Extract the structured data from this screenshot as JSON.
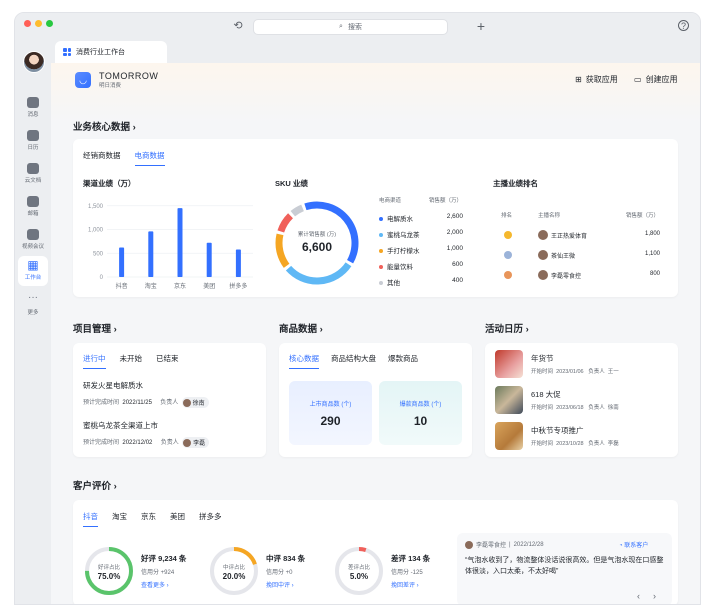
{
  "colors": {
    "accent": "#3370ff",
    "green": "#5ac46b",
    "orange": "#f5a623",
    "red": "#f0605a"
  },
  "app": {
    "search_placeholder": "搜索"
  },
  "sidebar": {
    "items": [
      {
        "label": "消息",
        "icon": "chat-icon"
      },
      {
        "label": "日历",
        "icon": "calendar-icon"
      },
      {
        "label": "云文档",
        "icon": "doc-icon"
      },
      {
        "label": "邮箱",
        "icon": "mail-icon"
      },
      {
        "label": "视频会议",
        "icon": "video-icon"
      },
      {
        "label": "工作台",
        "icon": "apps-icon"
      },
      {
        "label": "更多",
        "icon": "more-icon"
      }
    ]
  },
  "tab": {
    "title": "消费行业工作台"
  },
  "brand": {
    "name": "TOMORROW",
    "sub": "明日消费"
  },
  "header": {
    "get_app": "获取应用",
    "create_app": "创建应用"
  },
  "business": {
    "title": "业务核心数据",
    "tabs": [
      "经销商数据",
      "电商数据"
    ],
    "active_tab": 1,
    "channel_title": "渠道业绩（万）",
    "sku_title": "SKU 业绩",
    "anchor_title": "主播业绩排名"
  },
  "chart_data": {
    "type": "bar",
    "title": "渠道业绩（万）",
    "categories": [
      "抖音",
      "淘宝",
      "京东",
      "美团",
      "拼多多"
    ],
    "values": [
      620,
      960,
      1450,
      720,
      580
    ],
    "yticks": [
      0,
      500,
      1000,
      1500
    ],
    "ytick_labels": [
      "0",
      "500",
      "1,000",
      "1,500"
    ],
    "ylim": [
      0,
      1600
    ],
    "grid": true
  },
  "sku": {
    "center_label": "累计销售额 (万)",
    "center_value": "6,600",
    "col_channel": "电商渠道",
    "col_sales": "销售额（万）",
    "rows": [
      {
        "name": "电解质水",
        "value": "2,600",
        "num": 2600,
        "color": "#3370ff"
      },
      {
        "name": "蜜桃乌龙茶",
        "value": "2,000",
        "num": 2000,
        "color": "#5fb8f5"
      },
      {
        "name": "手打柠檬水",
        "value": "1,000",
        "num": 1000,
        "color": "#f5a623"
      },
      {
        "name": "能量饮料",
        "value": "600",
        "num": 600,
        "color": "#f0605a"
      },
      {
        "name": "其他",
        "value": "400",
        "num": 400,
        "color": "#c9cdd4"
      }
    ]
  },
  "anchors": {
    "col_rank": "排名",
    "col_name": "主播名称",
    "col_sales": "销售额（万）",
    "rows": [
      {
        "name": "王正热爱体育",
        "value": "1,800",
        "medal": "#f5b82e"
      },
      {
        "name": "茶仙王微",
        "value": "1,100",
        "medal": "#9bb3d9"
      },
      {
        "name": "李磊零食控",
        "value": "800",
        "medal": "#e8955a"
      }
    ]
  },
  "projects": {
    "title": "项目管理",
    "tabs": [
      "进行中",
      "未开始",
      "已结束"
    ],
    "items": [
      {
        "name": "研发火星电解质水",
        "due_label": "预计完成时间",
        "due": "2022/11/25",
        "owner_label": "负责人",
        "owner": "徐南"
      },
      {
        "name": "蜜桃乌龙茶全渠道上市",
        "due_label": "预计完成时间",
        "due": "2022/12/02",
        "owner_label": "负责人",
        "owner": "李磊"
      }
    ]
  },
  "goods": {
    "title": "商品数据",
    "tabs": [
      "核心数据",
      "商品结构大盘",
      "爆款商品"
    ],
    "stats": [
      {
        "label": "上市商品数 (个)",
        "value": "290"
      },
      {
        "label": "爆款商品数 (个)",
        "value": "10"
      }
    ]
  },
  "events": {
    "title": "活动日历",
    "items": [
      {
        "name": "年货节",
        "start_label": "开始时间",
        "start": "2023/01/06",
        "owner_label": "负责人",
        "owner": "王一"
      },
      {
        "name": "618 大促",
        "start_label": "开始时间",
        "start": "2023/06/18",
        "owner_label": "负责人",
        "owner": "徐南"
      },
      {
        "name": "中秋节专项推广",
        "start_label": "开始时间",
        "start": "2023/10/28",
        "owner_label": "负责人",
        "owner": "李磊"
      }
    ]
  },
  "reviews": {
    "title": "客户评价",
    "tabs": [
      "抖音",
      "淘宝",
      "京东",
      "美团",
      "拼多多"
    ],
    "gauges": [
      {
        "ring_label": "好评占比",
        "pct": "75.0%",
        "frac": 0.75,
        "color": "#5ac46b",
        "title": "好评 9,234 条",
        "credit": "信用分 +924",
        "link": "查看更多"
      },
      {
        "ring_label": "中评占比",
        "pct": "20.0%",
        "frac": 0.2,
        "color": "#f5a623",
        "title": "中评 834 条",
        "credit": "信用分 +0",
        "link": "挽回中评"
      },
      {
        "ring_label": "差评占比",
        "pct": "5.0%",
        "frac": 0.05,
        "color": "#f0605a",
        "title": "差评 134 条",
        "credit": "信用分 -125",
        "link": "挽回差评"
      }
    ],
    "comment": {
      "user": "李磊零食控",
      "date": "2022/12/28",
      "contact": "联系客户",
      "text": "“气泡水收到了，物流整体没话说很高效。但是气泡水现在口感整体很淡，入口太柔，不太好喝”"
    }
  }
}
